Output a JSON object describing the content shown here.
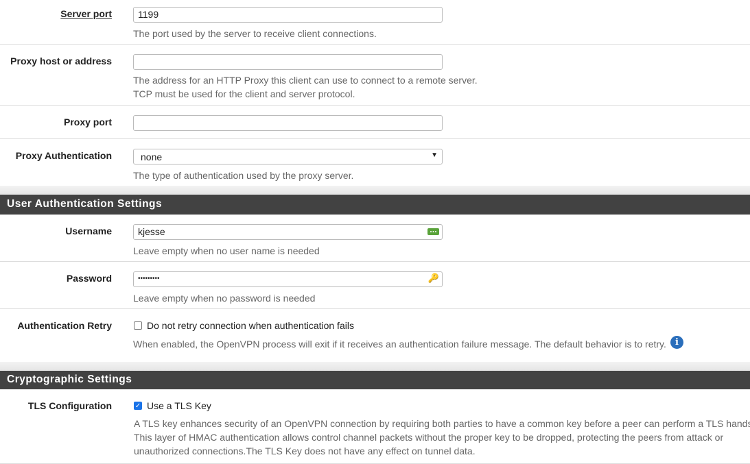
{
  "server_port": {
    "label": "Server port",
    "value": "1199",
    "help": "The port used by the server to receive client connections."
  },
  "proxy_host": {
    "label": "Proxy host or address",
    "value": "",
    "help": [
      "The address for an HTTP Proxy this client can use to connect to a remote server.",
      "TCP must be used for the client and server protocol."
    ]
  },
  "proxy_port": {
    "label": "Proxy port",
    "value": ""
  },
  "proxy_auth": {
    "label": "Proxy Authentication",
    "value": "none",
    "help": "The type of authentication used by the proxy server."
  },
  "user_auth": {
    "title": "User Authentication Settings",
    "username": {
      "label": "Username",
      "value": "kjesse",
      "help": "Leave empty when no user name is needed"
    },
    "password": {
      "label": "Password",
      "value": "•••••••••",
      "help": "Leave empty when no password is needed"
    },
    "retry": {
      "label": "Authentication Retry",
      "checkbox": "Do not retry connection when authentication fails",
      "checked": false,
      "help": "When enabled, the OpenVPN process will exit if it receives an authentication failure message. The default behavior is to retry."
    }
  },
  "crypto": {
    "title": "Cryptographic Settings",
    "tls": {
      "label": "TLS Configuration",
      "checkbox": "Use a TLS Key",
      "checked": true,
      "help": [
        "A TLS key enhances security of an OpenVPN connection by requiring both parties to have a common key before a peer can perform a TLS handshake.",
        "This layer of HMAC authentication allows control channel packets without the proper key to be dropped, protecting the peers from attack or",
        "unauthorized connections.The TLS Key does not have any effect on tunnel data."
      ]
    }
  },
  "colors": {
    "header_bg": "#424242",
    "info": "#2a6ebb",
    "checkbox": "#1a73e8"
  }
}
